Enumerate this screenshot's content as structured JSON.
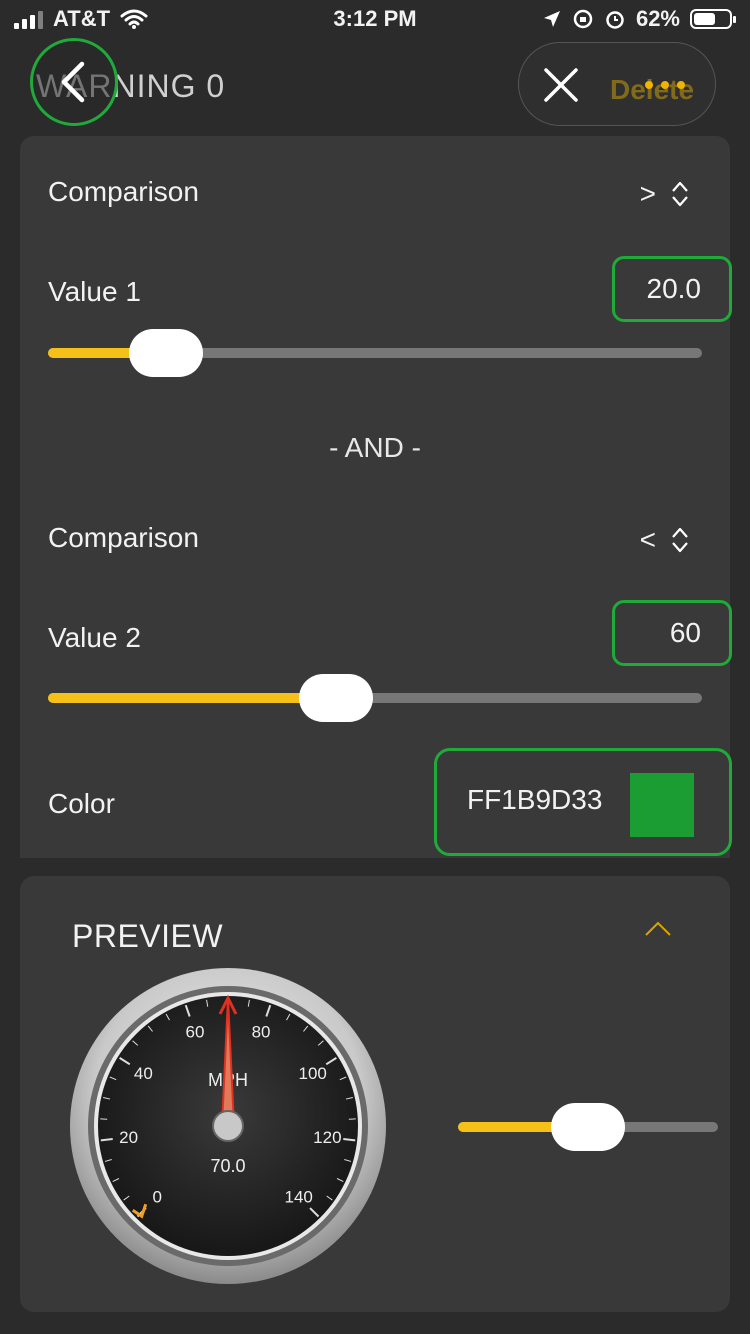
{
  "status_bar": {
    "carrier": "AT&T",
    "time": "3:12 PM",
    "battery": "62%",
    "battery_level": 0.62
  },
  "header": {
    "title": "WARNING 0",
    "delete_label": "Delete",
    "icons": [
      "back-icon",
      "close-icon",
      "more-icon"
    ]
  },
  "rule": {
    "comparison_label": "Comparison",
    "comparison1": ">",
    "value1_label": "Value 1",
    "value1": "20.0",
    "value1_fraction": 0.18,
    "and_label": "- AND -",
    "comparison2": "<",
    "value2_label": "Value 2",
    "value2": "60",
    "value2_fraction": 0.44,
    "color_label": "Color",
    "color_value": "FF1B9D33",
    "color_hex": "#1B9D33"
  },
  "preview": {
    "title": "PREVIEW",
    "gauge": {
      "unit": "MPH",
      "value_text": "70.0",
      "value": 70,
      "min": 0,
      "max": 140,
      "tick_labels": [
        "0",
        "20",
        "40",
        "60",
        "80",
        "100",
        "120",
        "140"
      ]
    },
    "slider_fraction": 0.5
  },
  "colors": {
    "accent": "#F5C018",
    "highlight": "#1FAA3A",
    "needle": "#E03020",
    "marker": "#F0A020"
  }
}
